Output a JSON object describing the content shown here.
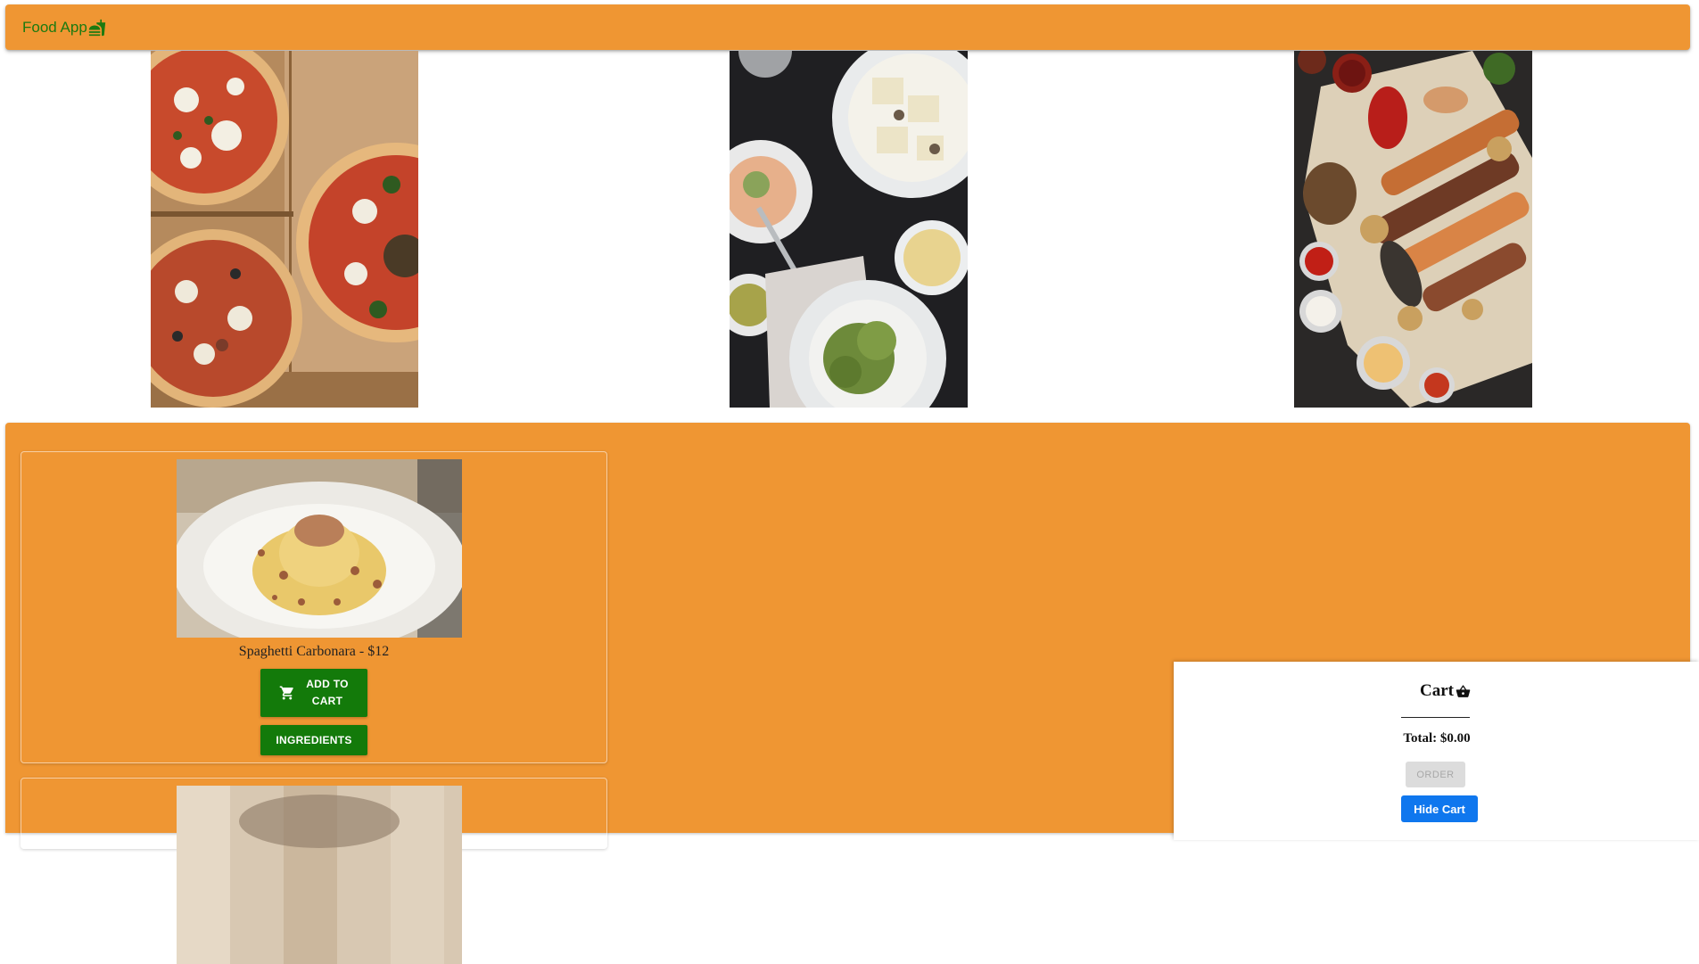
{
  "header": {
    "brand": "Food App",
    "brand_icon": "fast-food-icon",
    "brand_color": "#1c7a10",
    "background": "#ef9633"
  },
  "hero": {
    "images": [
      {
        "subject": "pizzas-in-boxes"
      },
      {
        "subject": "pasta-and-ravioli-table"
      },
      {
        "subject": "grilled-meat-skewers"
      }
    ]
  },
  "menu": {
    "background": "#ef9633",
    "meals": [
      {
        "title": "Spaghetti Carbonara - $12",
        "add_to_cart_line1": "Add to",
        "add_to_cart_line2": "Cart",
        "add_to_cart_icon": "shopping-cart-icon",
        "ingredients_label": "Ingredients"
      },
      {
        "title": ""
      }
    ]
  },
  "cart": {
    "title": "Cart",
    "icon": "basket-icon",
    "total": "Total: $0.00",
    "order_label": "Order",
    "hide_label": "Hide Cart",
    "hide_color": "#0f77ee",
    "order_disabled": true
  }
}
